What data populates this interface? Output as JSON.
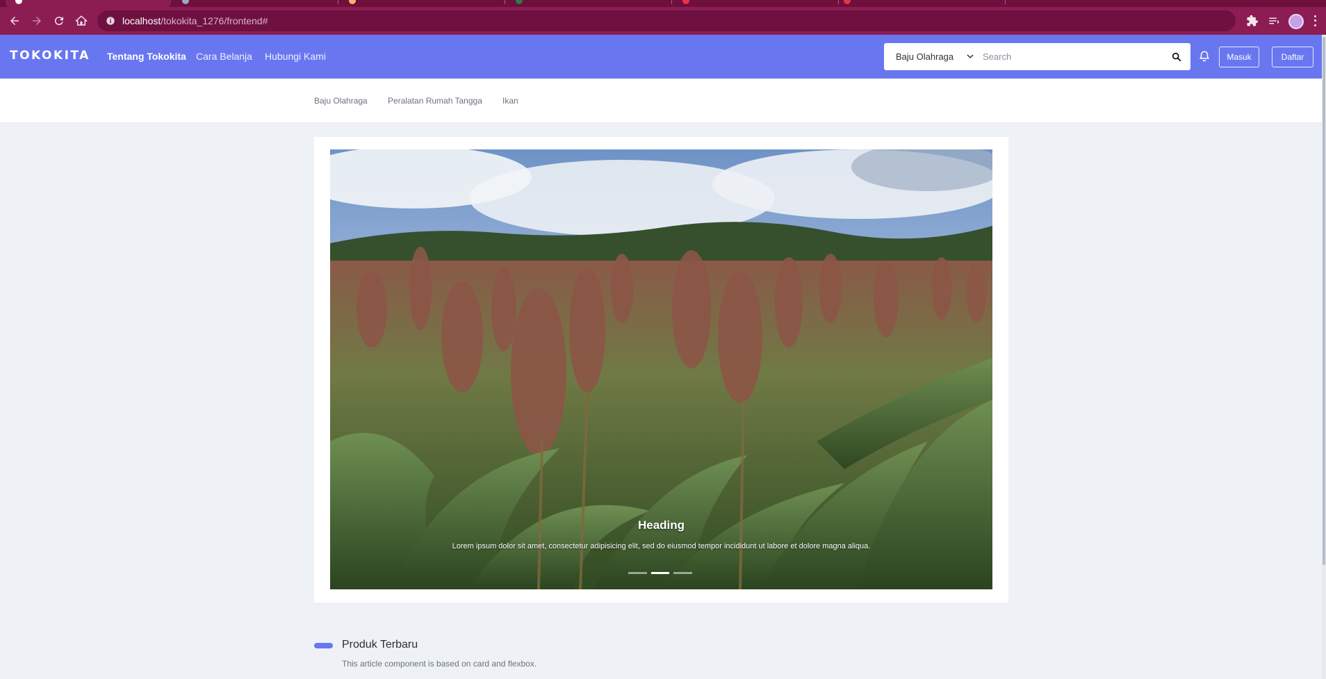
{
  "browser": {
    "url_host": "localhost",
    "url_path": "/tokokita_1276/frontend#",
    "icons": [
      "back-icon",
      "forward-icon",
      "reload-icon",
      "home-icon",
      "site-info-icon",
      "extensions-icon",
      "reading-list-icon",
      "profile-avatar",
      "menu-icon"
    ],
    "colors": {
      "frame": "#8c1d52",
      "tabstrip": "#6e0f3c",
      "omnibox": "#6f1140"
    }
  },
  "navbar": {
    "brand": "TOKOKITA",
    "links": [
      "Tentang Tokokita",
      "Cara Belanja",
      "Hubungi Kami"
    ],
    "search": {
      "category": "Baju Olahraga",
      "placeholder": "Search"
    },
    "login_label": "Masuk",
    "register_label": "Daftar",
    "color": "#6877f0"
  },
  "categories": [
    "Baju Olahraga",
    "Peralatan Rumah Tangga",
    "Ikan"
  ],
  "carousel": {
    "heading": "Heading",
    "text": "Lorem ipsum dolor sit amet, consectetur adipisicing elit, sed do eiusmod tempor incididunt ut labore et dolore magna aliqua.",
    "slide_count": 3,
    "active_slide": 2
  },
  "section": {
    "title": "Produk Terbaru",
    "subtitle": "This article component is based on card and flexbox."
  }
}
